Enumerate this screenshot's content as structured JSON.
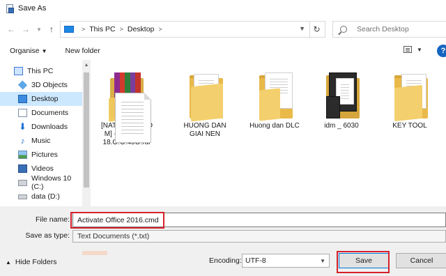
{
  "window": {
    "title": "Save As"
  },
  "address": {
    "crumbs": [
      "This PC",
      "Desktop"
    ],
    "search_placeholder": "Search Desktop"
  },
  "toolbar": {
    "organise_label": "Organise",
    "new_folder_label": "New folder",
    "help_label": "?"
  },
  "sidebar": {
    "items": [
      {
        "label": "This PC",
        "icon": "monitor-icon",
        "selected": false
      },
      {
        "label": "3D Objects",
        "icon": "cube-icon",
        "selected": false
      },
      {
        "label": "Desktop",
        "icon": "desktop-icon",
        "selected": true
      },
      {
        "label": "Documents",
        "icon": "documents-icon",
        "selected": false
      },
      {
        "label": "Downloads",
        "icon": "download-icon",
        "selected": false
      },
      {
        "label": "Music",
        "icon": "music-icon",
        "selected": false
      },
      {
        "label": "Pictures",
        "icon": "pictures-icon",
        "selected": false
      },
      {
        "label": "Videos",
        "icon": "videos-icon",
        "selected": false
      },
      {
        "label": "Windows 10 (C:)",
        "icon": "drive-icon",
        "selected": false
      },
      {
        "label": "data (D:)",
        "icon": "drive-icon",
        "selected": false
      }
    ]
  },
  "files": [
    {
      "name": "[NATUTOOL.COM] - C0REI X8 18.O.O.45O.rar",
      "type": "rar-archive",
      "lines": [
        "[NATUTOOL.CO",
        "M] - C0REI X8",
        "18.O.O.45O.rar"
      ]
    },
    {
      "name": "HUONG DAN GIAI NEN",
      "type": "folder",
      "lines": [
        "HUONG DAN",
        "GIAI NEN"
      ]
    },
    {
      "name": "Huong dan DLC",
      "type": "folder",
      "lines": [
        "Huong dan DLC"
      ]
    },
    {
      "name": "idm _ 6030",
      "type": "folder",
      "lines": [
        "idm _ 6030"
      ]
    },
    {
      "name": "KEY TOOL",
      "type": "folder",
      "lines": [
        "KEY TOOL"
      ]
    },
    {
      "name": "",
      "type": "text-document",
      "lines": []
    }
  ],
  "form": {
    "file_name_label": "File name:",
    "file_name_value": "Activate Office 2016.cmd",
    "save_as_type_label": "Save as type:",
    "save_as_type_value": "Text Documents (*.txt)",
    "hide_folders_label": "Hide Folders",
    "encoding_label": "Encoding:",
    "encoding_value": "UTF-8",
    "save_label": "Save",
    "cancel_label": "Cancel"
  },
  "colors": {
    "highlight": "#d6202a",
    "selection": "#cce8ff",
    "accent": "#0078d7"
  }
}
